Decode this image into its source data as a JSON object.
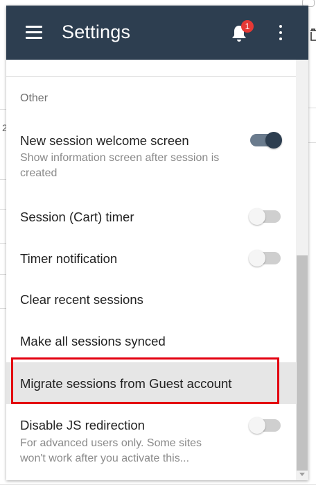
{
  "header": {
    "title": "Settings",
    "notification_count": "1",
    "bg_color": "#2d3e50",
    "badge_color": "#e53935"
  },
  "background": {
    "fragment_text": "2"
  },
  "section": {
    "label": "Other"
  },
  "rows": [
    {
      "title": "New session welcome screen",
      "subtitle": "Show information screen after session is created",
      "toggle": true
    },
    {
      "title": "Session (Cart) timer",
      "subtitle": "",
      "toggle": false
    },
    {
      "title": "Timer notification",
      "subtitle": "",
      "toggle": false
    },
    {
      "title": "Clear recent sessions"
    },
    {
      "title": "Make all sessions synced"
    },
    {
      "title": "Migrate sessions from Guest account",
      "highlighted": true
    },
    {
      "title": "Disable JS redirection",
      "subtitle": "For advanced users only. Some sites won't work after you activate this...",
      "toggle": false
    }
  ],
  "colors": {
    "accent": "#2d3e50",
    "highlight_border": "#e3000f",
    "highlight_bg": "#e6e6e6"
  }
}
